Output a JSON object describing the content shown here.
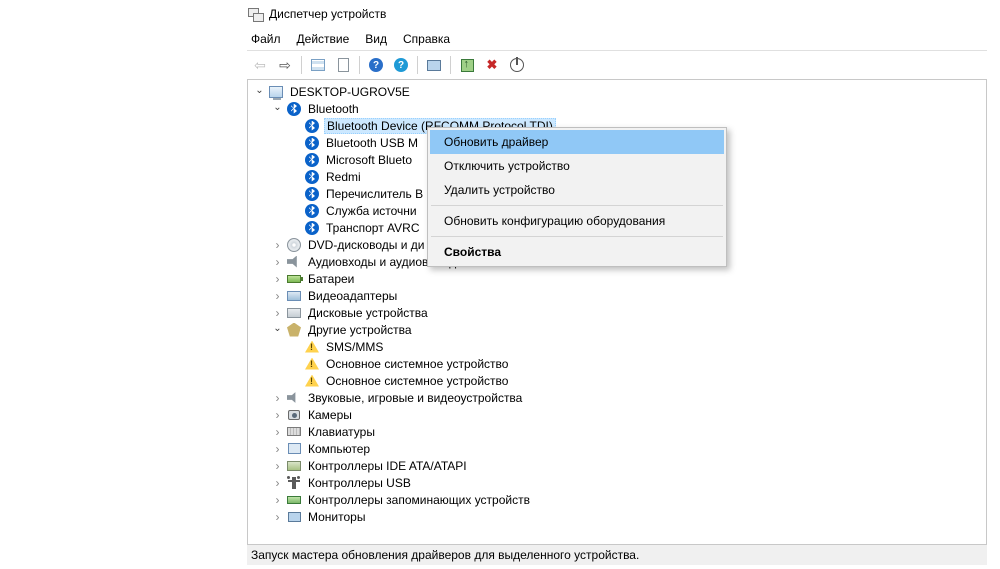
{
  "title": "Диспетчер устройств",
  "menu": {
    "file": "Файл",
    "action": "Действие",
    "view": "Вид",
    "help": "Справка"
  },
  "root": "DESKTOP-UGROV5E",
  "bluetooth": {
    "label": "Bluetooth",
    "items": [
      "Bluetooth Device (RFCOMM Protocol TDI)",
      "Bluetooth USB M",
      "Microsoft Blueto",
      "Redmi",
      "Перечислитель B",
      "Служба источни",
      "Транспорт AVRC"
    ]
  },
  "cats": {
    "dvd": "DVD-дисководы и ди",
    "audio": "Аудиовходы и аудиовыходы",
    "bat": "Батареи",
    "vid": "Видеоадаптеры",
    "disk": "Дисковые устройства",
    "other": "Другие устройства",
    "other_items": [
      "SMS/MMS",
      "Основное системное устройство",
      "Основное системное устройство"
    ],
    "snd": "Звуковые, игровые и видеоустройства",
    "cam": "Камеры",
    "kbd": "Клавиатуры",
    "comp": "Компьютер",
    "ide": "Контроллеры IDE ATA/ATAPI",
    "usb": "Контроллеры USB",
    "mem": "Контроллеры запоминающих устройств",
    "mon": "Мониторы"
  },
  "ctx": {
    "update": "Обновить драйвер",
    "disable": "Отключить устройство",
    "uninstall": "Удалить устройство",
    "scan": "Обновить конфигурацию оборудования",
    "props": "Свойства"
  },
  "status": "Запуск мастера обновления драйверов для выделенного устройства."
}
